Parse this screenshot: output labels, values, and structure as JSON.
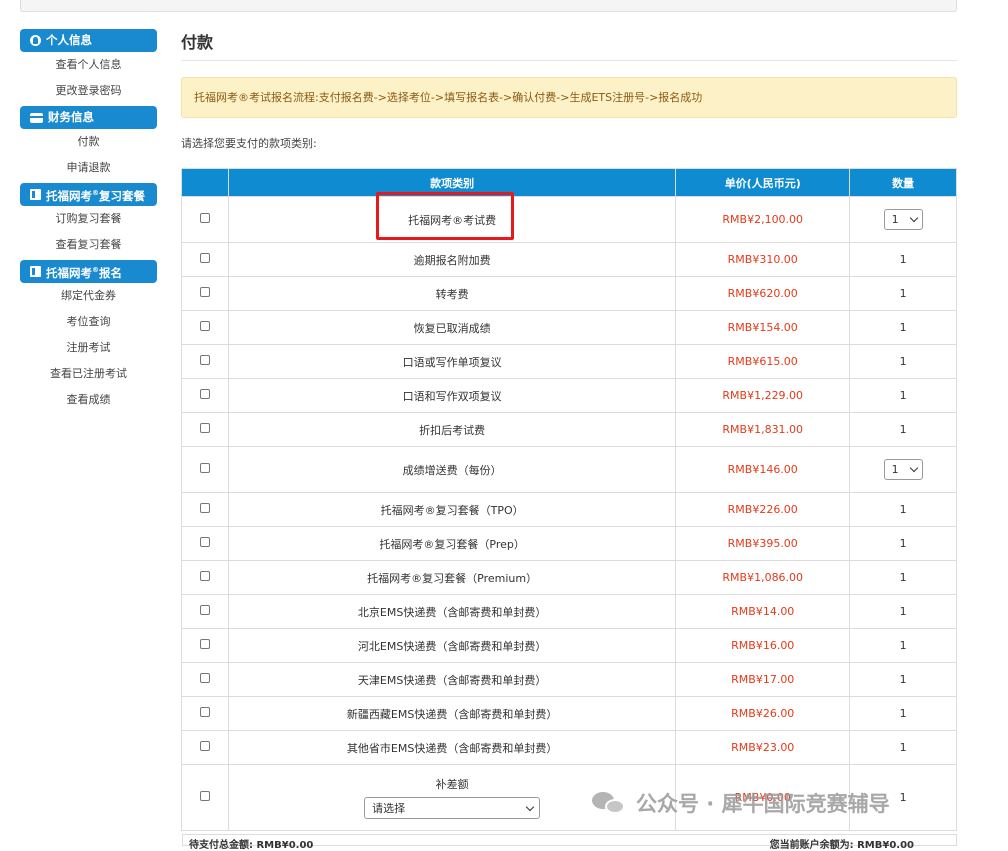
{
  "sidebar": {
    "groups": [
      {
        "title": "个人信息",
        "icon": "user-icon",
        "items": [
          "查看个人信息",
          "更改登录密码"
        ]
      },
      {
        "title": "财务信息",
        "icon": "card-icon",
        "items": [
          "付款",
          "申请退款"
        ]
      },
      {
        "title_prefix": "托福网考",
        "title_suffix": "复习套餐",
        "icon": "book-icon",
        "items": [
          "订购复习套餐",
          "查看复习套餐"
        ]
      },
      {
        "title_prefix": "托福网考",
        "title_suffix": "报名",
        "icon": "book-icon",
        "items": [
          "绑定代金券",
          "考位查询",
          "注册考试",
          "查看已注册考试",
          "查看成绩"
        ]
      }
    ],
    "reg_mark": "®"
  },
  "main": {
    "title": "付款",
    "notice": "托福网考®考试报名流程:支付报名费->选择考位->填写报名表->确认付费->生成ETS注册号->报名成功",
    "prompt": "请选择您要支付的款项类别:",
    "table": {
      "headers": [
        "",
        "款项类别",
        "单价(人民币元)",
        "数量"
      ],
      "rows": [
        {
          "name": "托福网考®考试费",
          "price": "RMB¥2,100.00",
          "qty": "1",
          "qty_select": true
        },
        {
          "name": "逾期报名附加费",
          "price": "RMB¥310.00",
          "qty": "1"
        },
        {
          "name": "转考费",
          "price": "RMB¥620.00",
          "qty": "1"
        },
        {
          "name": "恢复已取消成绩",
          "price": "RMB¥154.00",
          "qty": "1"
        },
        {
          "name": "口语或写作单项复议",
          "price": "RMB¥615.00",
          "qty": "1"
        },
        {
          "name": "口语和写作双项复议",
          "price": "RMB¥1,229.00",
          "qty": "1"
        },
        {
          "name": "折扣后考试费",
          "price": "RMB¥1,831.00",
          "qty": "1"
        },
        {
          "name": "成绩增送费（每份）",
          "price": "RMB¥146.00",
          "qty": "1",
          "qty_select": true
        },
        {
          "name": "托福网考®复习套餐（TPO）",
          "price": "RMB¥226.00",
          "qty": "1"
        },
        {
          "name": "托福网考®复习套餐（Prep）",
          "price": "RMB¥395.00",
          "qty": "1"
        },
        {
          "name": "托福网考®复习套餐（Premium）",
          "price": "RMB¥1,086.00",
          "qty": "1"
        },
        {
          "name": "北京EMS快递费（含邮寄费和单封费）",
          "price": "RMB¥14.00",
          "qty": "1"
        },
        {
          "name": "河北EMS快递费（含邮寄费和单封费）",
          "price": "RMB¥16.00",
          "qty": "1"
        },
        {
          "name": "天津EMS快递费（含邮寄费和单封费）",
          "price": "RMB¥17.00",
          "qty": "1"
        },
        {
          "name": "新疆西藏EMS快递费（含邮寄费和单封费）",
          "price": "RMB¥26.00",
          "qty": "1"
        },
        {
          "name": "其他省市EMS快递费（含邮寄费和单封费）",
          "price": "RMB¥23.00",
          "qty": "1"
        }
      ],
      "supplement": {
        "name": "补差额",
        "select_value": "请选择",
        "price": "RMB¥0.00",
        "qty": "1"
      }
    },
    "footer": {
      "left": "待支付总金额: RMB¥0.00",
      "right": "您当前账户余额为: RMB¥0.00"
    }
  },
  "watermark": "公众号 · 犀牛国际竞赛辅导",
  "colors": {
    "header_blue": "#0f8bd2",
    "price_red": "#e43a1a",
    "highlight_red": "#e8191c",
    "notice_bg": "#fcf1c7"
  }
}
